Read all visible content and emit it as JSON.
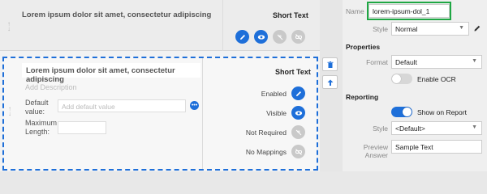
{
  "colors": {
    "accent": "#1e6fd9",
    "highlight": "#1fa744",
    "icon_off": "#c9c9c9"
  },
  "canvas": {
    "row1": {
      "title": "Lorem ipsum dolor sit amet, consectetur adipiscing",
      "type": "Short Text",
      "icons": [
        "edit-icon",
        "eye-icon",
        "required-off-icon",
        "mapping-off-icon"
      ]
    },
    "row2": {
      "title": "Lorem ipsum dolor sit amet, consectetur adipiscing",
      "description_placeholder": "Add Description",
      "default_value_label": "Default value:",
      "default_value_placeholder": "Add default value",
      "max_length_label": "Maximum Length:",
      "type": "Short Text",
      "props": [
        {
          "label": "Enabled",
          "icon": "edit-icon",
          "on": true
        },
        {
          "label": "Visible",
          "icon": "eye-icon",
          "on": true
        },
        {
          "label": "Not Required",
          "icon": "required-off-icon",
          "on": false
        },
        {
          "label": "No Mappings",
          "icon": "mapping-off-icon",
          "on": false
        }
      ]
    }
  },
  "tools": {
    "delete_icon": "trash-icon",
    "up_icon": "arrow-up-icon"
  },
  "panel": {
    "name_label": "Name",
    "name_value": "lorem-ipsum-dol_1",
    "style_label": "Style",
    "style_value": "Normal",
    "properties_heading": "Properties",
    "format_label": "Format",
    "format_value": "Default",
    "enable_ocr_label": "Enable OCR",
    "enable_ocr_on": false,
    "reporting_heading": "Reporting",
    "show_on_report_label": "Show on Report",
    "show_on_report_on": true,
    "report_style_label": "Style",
    "report_style_value": "<Default>",
    "preview_label": "Preview Answer",
    "preview_value": "Sample Text"
  }
}
